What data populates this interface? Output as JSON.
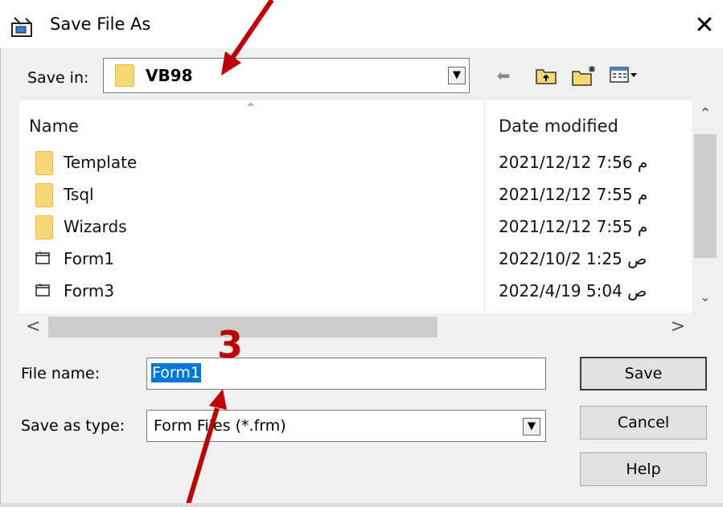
{
  "window": {
    "title": "Save File As",
    "close_glyph": "✕"
  },
  "save_in": {
    "label": "Save in:",
    "value": "VB98",
    "arrow": "▼"
  },
  "toolbar": {
    "back": "⬅",
    "up_folder": "up-folder-icon",
    "new_folder": "new-folder-icon",
    "view_menu": "view-menu-icon"
  },
  "list": {
    "columns": {
      "name": "Name",
      "date": "Date modified"
    },
    "sort_glyph": "⌃",
    "rows": [
      {
        "name": "Template",
        "date": "2021/12/12 م 7:56",
        "type": "folder"
      },
      {
        "name": "Tsql",
        "date": "2021/12/12 م 7:55",
        "type": "folder"
      },
      {
        "name": "Wizards",
        "date": "2021/12/12 م 7:55",
        "type": "folder"
      },
      {
        "name": "Form1",
        "date": "2022/10/2 ص 1:25",
        "type": "form"
      },
      {
        "name": "Form3",
        "date": "2022/4/19 ص 5:04",
        "type": "form"
      }
    ],
    "scroll": {
      "up": "⌃",
      "down": "⌄",
      "left": "<",
      "right": ">"
    }
  },
  "file_name": {
    "label": "File name:",
    "value": "Form1"
  },
  "save_as_type": {
    "label": "Save as type:",
    "value": "Form Files (*.frm)",
    "arrow": "▼"
  },
  "buttons": {
    "save": "Save",
    "cancel": "Cancel",
    "help": "Help"
  },
  "annotation": {
    "number": "3",
    "color": "#c00000"
  }
}
